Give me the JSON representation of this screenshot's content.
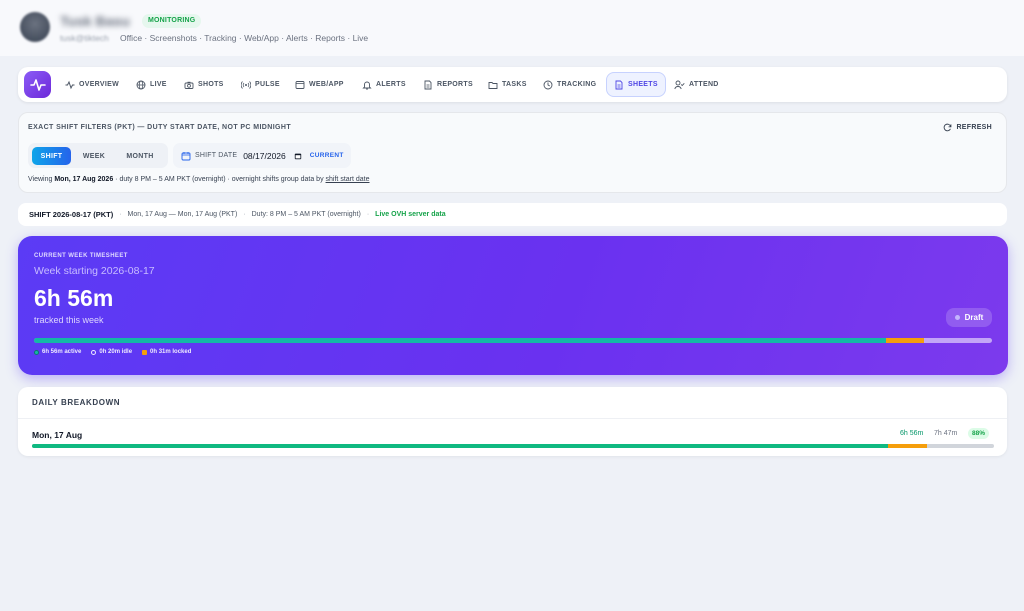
{
  "header": {
    "user_name": "Tusk Basu",
    "status_badge": "MONITORING",
    "user_email": "tusk@tiktech",
    "breadcrumbs": "Office · Screenshots · Tracking · Web/App · Alerts · Reports · Live"
  },
  "nav": {
    "items": [
      {
        "label": "OVERVIEW",
        "icon": "activity-icon"
      },
      {
        "label": "LIVE",
        "icon": "globe-icon"
      },
      {
        "label": "SHOTS",
        "icon": "camera-icon"
      },
      {
        "label": "PULSE",
        "icon": "broadcast-icon"
      },
      {
        "label": "WEB/APP",
        "icon": "browser-icon"
      },
      {
        "label": "ALERTS",
        "icon": "bell-icon"
      },
      {
        "label": "REPORTS",
        "icon": "report-icon"
      },
      {
        "label": "TASKS",
        "icon": "folder-icon"
      },
      {
        "label": "TRACKING",
        "icon": "clock-icon"
      },
      {
        "label": "SHEETS",
        "icon": "sheet-icon",
        "active": true
      },
      {
        "label": "ATTEND",
        "icon": "user-check-icon"
      }
    ],
    "active_color": "#4f46e5"
  },
  "filters": {
    "title": "EXACT SHIFT FILTERS (PKT) — DUTY START DATE, NOT PC MIDNIGHT",
    "refresh_label": "REFRESH",
    "modes": [
      "SHIFT",
      "WEEK",
      "MONTH"
    ],
    "active_mode": "SHIFT",
    "date_label": "SHIFT DATE",
    "date_value": "08/17/2026",
    "current_label": "CURRENT",
    "viewing_prefix": "Viewing ",
    "viewing_date": "Mon, 17 Aug 2026",
    "viewing_mid": " · duty 8 PM – 5 AM PKT (overnight) · overnight shifts group data by ",
    "viewing_link": "shift start date"
  },
  "shift": {
    "label": "SHIFT 2026-08-17 (PKT)",
    "range": "Mon, 17 Aug — Mon, 17 Aug (PKT)",
    "duty": "Duty: 8 PM – 5 AM PKT (overnight)",
    "source": "Live OVH server data"
  },
  "week_card": {
    "kicker": "CURRENT WEEK TIMESHEET",
    "week_start": "Week starting 2026-08-17",
    "total": "6h 56m",
    "total_label": "tracked this week",
    "status": "Draft",
    "active_fraction": 0.889,
    "idle_fraction": 0.04,
    "legend_active": "6h 56m active",
    "legend_idle": "0h 20m idle",
    "legend_locked": "0h 31m locked",
    "colors": {
      "active": "#14b8a6",
      "idle": "#f59e0b",
      "locked": "#ffffff"
    }
  },
  "breakdown": {
    "title": "DAILY BREAKDOWN",
    "rows": [
      {
        "day": "Mon, 17 Aug",
        "active": "6h 56m",
        "total": "7h 47m",
        "percent": "88%",
        "active_fraction": 0.89,
        "idle_fraction": 0.04
      }
    ]
  }
}
